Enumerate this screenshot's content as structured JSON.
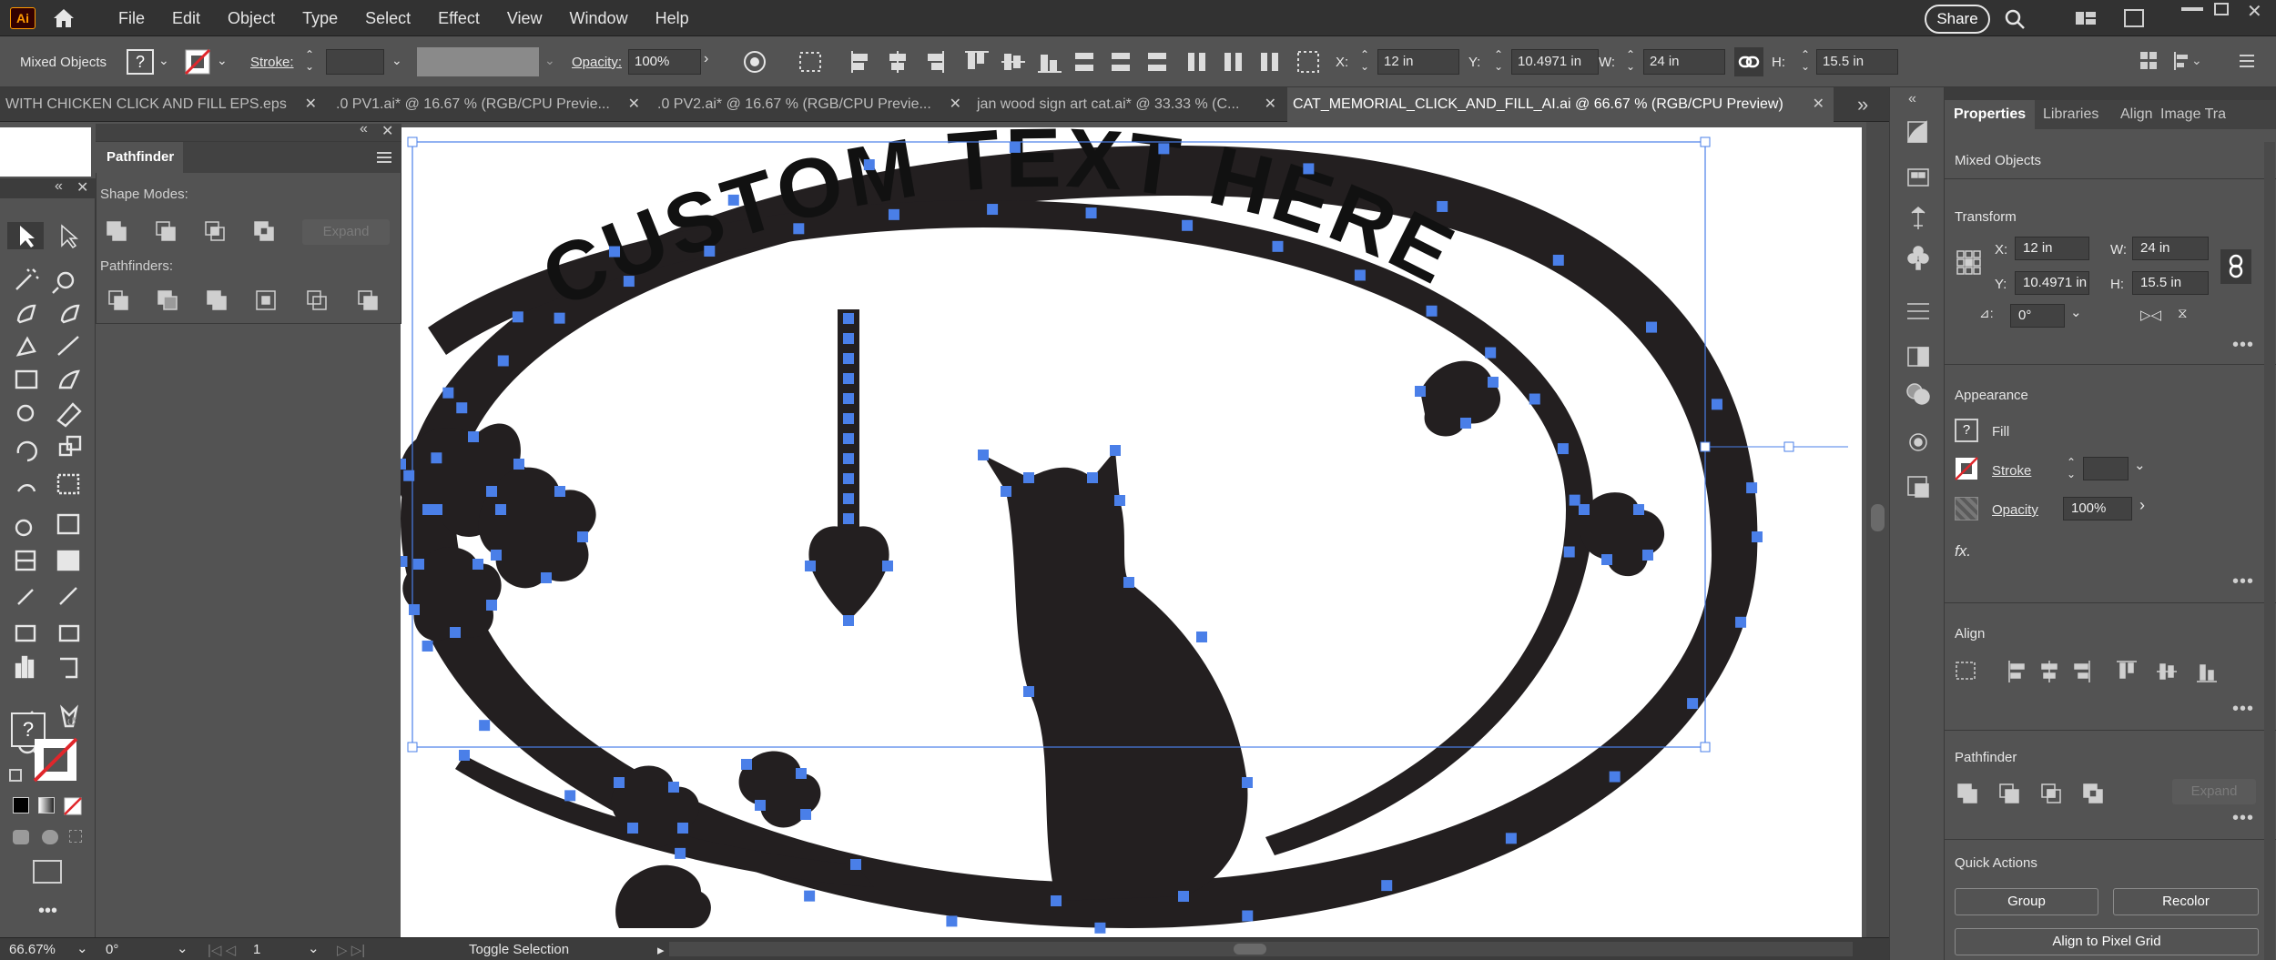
{
  "app": {
    "logo": "Ai"
  },
  "menu": [
    "File",
    "Edit",
    "Object",
    "Type",
    "Select",
    "Effect",
    "View",
    "Window",
    "Help"
  ],
  "share_label": "Share",
  "control": {
    "selection_type": "Mixed Objects",
    "stroke_label": "Stroke:",
    "opacity_label": "Opacity:",
    "opacity_value": "100%",
    "x_label": "X:",
    "x_value": "12 in",
    "y_label": "Y:",
    "y_value": "10.4971 in",
    "w_label": "W:",
    "w_value": "24 in",
    "h_label": "H:",
    "h_value": "15.5 in"
  },
  "tabs": [
    {
      "label": "WITH CHICKEN CLICK AND FILL EPS.eps"
    },
    {
      "label": ".0 PV1.ai* @ 16.67 % (RGB/CPU Previe..."
    },
    {
      "label": ".0 PV2.ai* @ 16.67 % (RGB/CPU Previe..."
    },
    {
      "label": "jan wood sign art cat.ai* @ 33.33 % (C..."
    },
    {
      "label": "CAT_MEMORIAL_CLICK_AND_FILL_AI.ai @ 66.67 % (RGB/CPU Preview)"
    }
  ],
  "tab_close": "✕",
  "pathfinder": {
    "title": "Pathfinder",
    "shape_modes": "Shape Modes:",
    "expand": "Expand",
    "pathfinders": "Pathfinders:"
  },
  "artwork": {
    "text": "CUSTOM TEXT HERE",
    "fill_color": "#231f20",
    "anchor_color": "#4a7fe8"
  },
  "right": {
    "tabs": [
      "Properties",
      "Libraries",
      "Align",
      "Image Tra"
    ],
    "selection": "Mixed Objects",
    "transform": "Transform",
    "x_label": "X:",
    "x_value": "12 in",
    "y_label": "Y:",
    "y_value": "10.4971 in",
    "w_label": "W:",
    "w_value": "24 in",
    "h_label": "H:",
    "h_value": "15.5 in",
    "angle_value": "0°",
    "appearance": "Appearance",
    "fill": "Fill",
    "stroke": "Stroke",
    "opacity": "Opacity",
    "opacity_value": "100%",
    "fx": "fx.",
    "align": "Align",
    "pathfinder": "Pathfinder",
    "expand": "Expand",
    "quick_actions": "Quick Actions",
    "group": "Group",
    "recolor": "Recolor",
    "align_pixel": "Align to Pixel Grid"
  },
  "status": {
    "zoom": "66.67%",
    "rotate": "0°",
    "artboard": "1",
    "info": "Toggle Selection"
  }
}
